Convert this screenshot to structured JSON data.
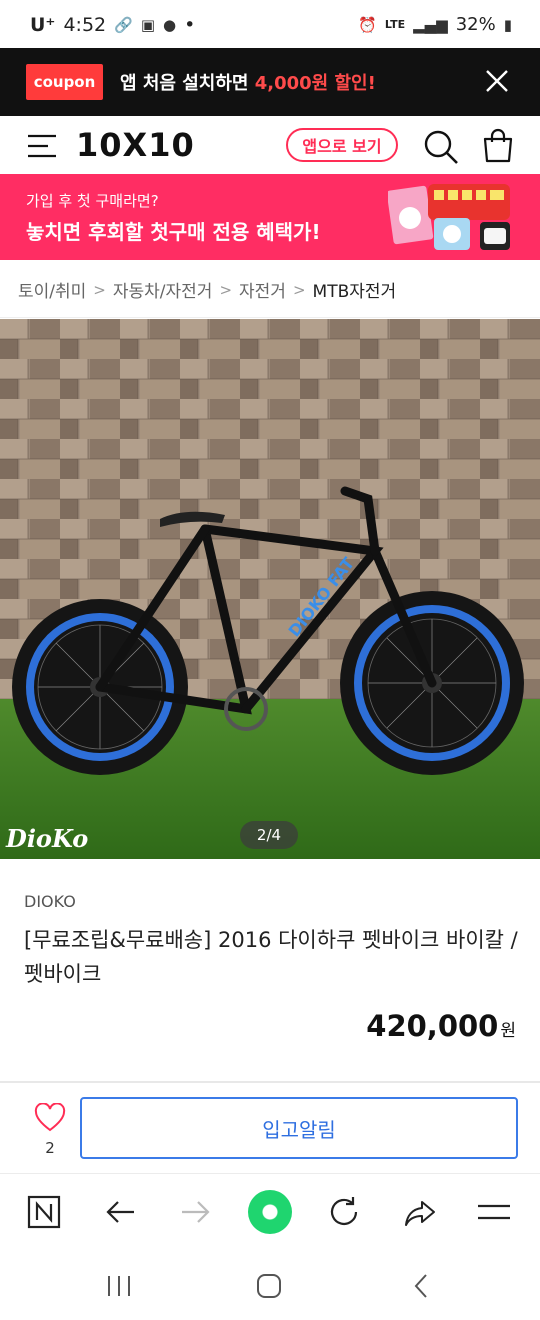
{
  "status_bar": {
    "carrier": "U⁺",
    "time": "4:52",
    "dot": "•",
    "network": "LTE",
    "battery": "32%"
  },
  "coupon_banner": {
    "tag": "coupon",
    "message_prefix": "앱 처음 설치하면 ",
    "message_highlight": "4,000원 할인!"
  },
  "header": {
    "logo": "10X10",
    "app_button": "앱으로 보기"
  },
  "promo": {
    "line1": "가입 후 첫 구매라면?",
    "line2": "놓치면 후회할 첫구매 전용 혜택가!"
  },
  "breadcrumb": [
    "토이/취미",
    "자동차/자전거",
    "자전거",
    "MTB자전거"
  ],
  "gallery": {
    "counter": "2/4",
    "watermark": "DioKo",
    "frame_text": "DIOKO FAT"
  },
  "product": {
    "brand": "DIOKO",
    "title": "[무료조립&무료배송] 2016 다이하쿠 펫바이크 바이칼 / 펫바이크",
    "price": "420,000",
    "currency": "원"
  },
  "actions": {
    "wishlist_count": "2",
    "notify_button": "입고알림"
  },
  "colors": {
    "accent": "#ff2d63",
    "coupon_red": "#ff3b3b",
    "notify_blue": "#2f6fe0",
    "browser_green": "#1fd56f"
  }
}
